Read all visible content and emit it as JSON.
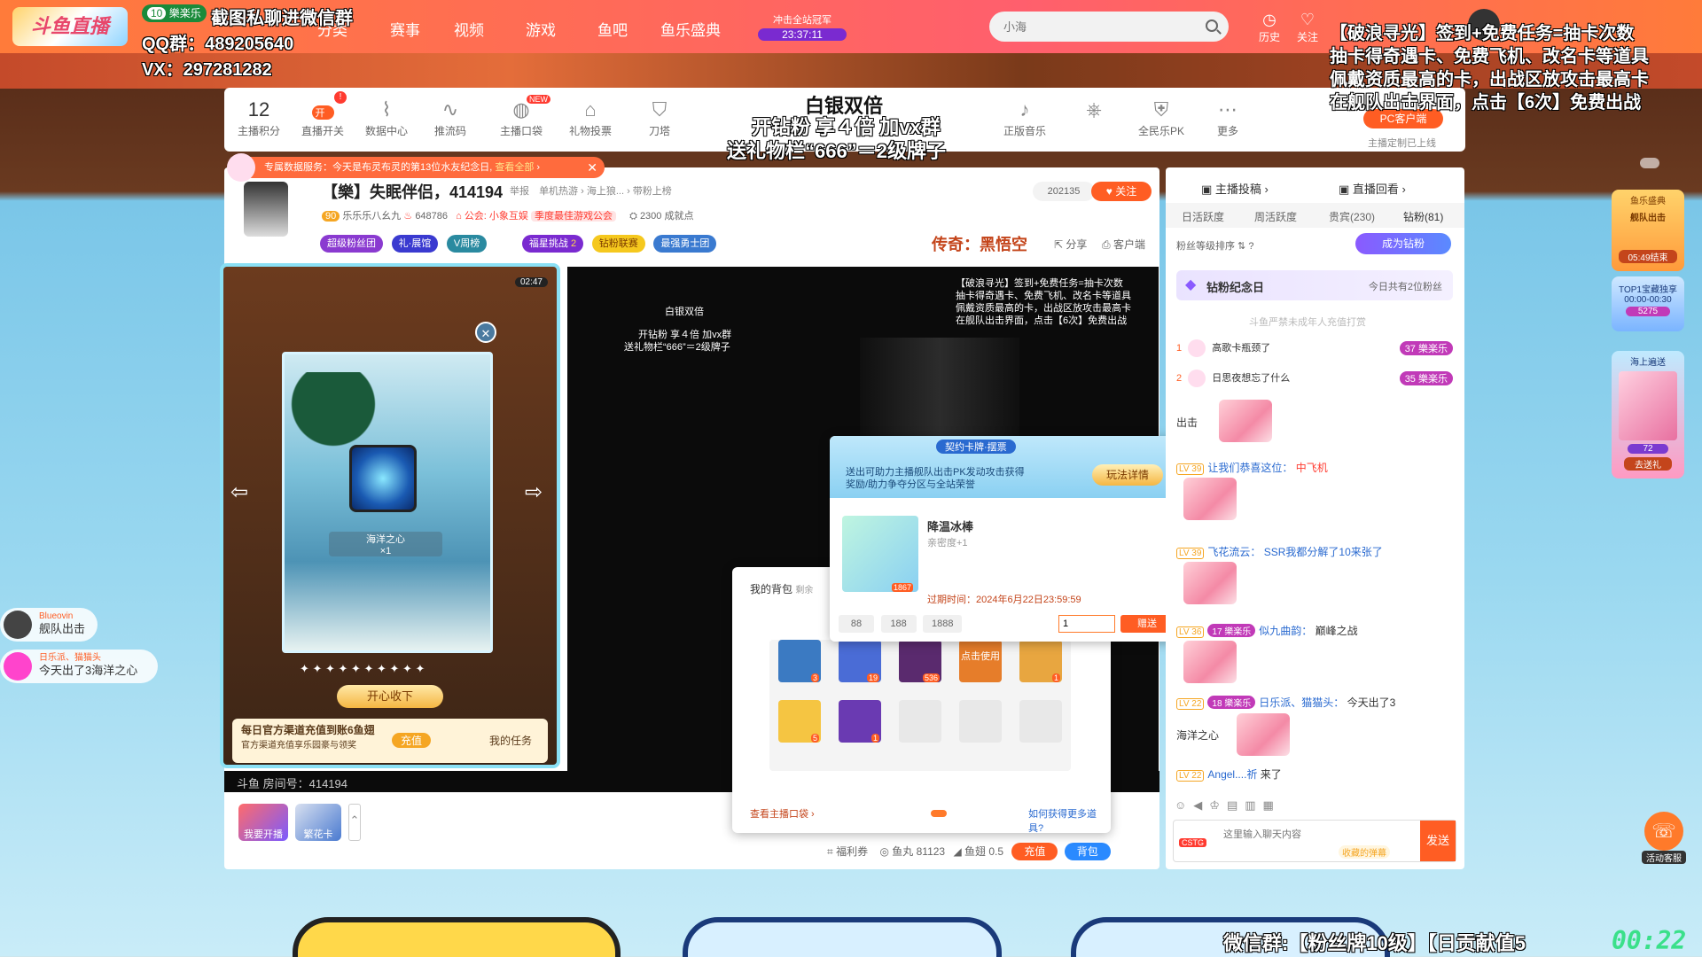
{
  "header": {
    "logo": "斗鱼直播",
    "fan_badge_level": "10",
    "fan_badge_name": "樂楽乐",
    "nav": [
      "分类",
      "赛事",
      "视频",
      "游戏",
      "鱼吧",
      "鱼乐盛典"
    ],
    "promo_title": "冲击全站冠军",
    "promo_timer": "23:37:11",
    "search_placeholder": "小海",
    "icons": [
      {
        "name": "history-icon",
        "label": "历史"
      },
      {
        "name": "follow-icon",
        "label": "关注"
      }
    ]
  },
  "overlay": {
    "screenshot_note": "截图私聊进微信群",
    "qq_group": "QQ群：489205640",
    "vx": "VX：297281282",
    "right_notice": [
      "【破浪寻光】签到+免费任务=抽卡次数",
      "抽卡得奇遇卡、免费飞机、改名卡等道具",
      "佩戴资质最高的卡，出战区放攻击最高卡",
      "在舰队出击界面，点击【6次】免费出战"
    ],
    "center_top": "白银双倍",
    "center_l1": "开钻粉 享４倍 加vx群",
    "center_l2": "送礼物栏“666”＝2级牌子",
    "bottom_right": "微信群:【粉丝牌10级】【日贡献值5",
    "bottom_timer": "00:22"
  },
  "toolbar": {
    "items": [
      {
        "name": "anchor-points",
        "value": "12",
        "label": "主播积分"
      },
      {
        "name": "live-toggle",
        "label": "直播开关",
        "toggle": "开"
      },
      {
        "name": "data-center",
        "label": "数据中心",
        "icon": "chart-icon"
      },
      {
        "name": "stream-code",
        "label": "推流码",
        "icon": "wave-icon"
      },
      {
        "name": "anchor-bag",
        "label": "主播口袋",
        "icon": "bag-icon",
        "badge": "NEW"
      },
      {
        "name": "gift-vote",
        "label": "礼物投票",
        "icon": "vote-icon"
      },
      {
        "name": "sword-tower",
        "label": "刀塔",
        "icon": "shield-icon"
      },
      {
        "name": "music",
        "label": "正版音乐",
        "icon": "music-icon"
      },
      {
        "name": "gift",
        "label": "",
        "icon": "gift-icon"
      },
      {
        "name": "pk",
        "label": "全民乐PK",
        "icon": "pk-icon"
      },
      {
        "name": "more",
        "label": "更多",
        "icon": "more-icon"
      }
    ],
    "pc_client": "PC客户端",
    "custom_note": "主播定制已上线"
  },
  "room": {
    "notice": "专属数据服务：今天是布灵布灵的第13位水友纪念日,",
    "notice_link": "查看全部",
    "title": "【樂】失眠伴侣，414194",
    "report": "举报",
    "breadcrumb": [
      "单机热游",
      "海上狼...",
      "带粉上榜"
    ],
    "level_badge": "90",
    "anchor_name": "乐乐乐八幺九",
    "heat": "648786",
    "guild": "公会: 小象互娱",
    "guild_tag": "季度最佳游戏公会",
    "achievements": "2300 成就点",
    "follower_count": "202135",
    "follow_label": "关注",
    "tags": [
      "超级粉丝团",
      "礼·展馆",
      "V周榜",
      "福星挑战",
      "钻粉联赛",
      "最强勇士团"
    ],
    "fuxing_level": "2",
    "game_name": "传奇：黑悟空",
    "share": "分享",
    "client": "客户端",
    "room_no": "斗鱼 房间号：414194",
    "bottom_actions": [
      "我要开播",
      "繁花卡"
    ],
    "wallet": {
      "fuli": "福利券",
      "yuwan": "鱼丸 81123",
      "yuchi": "鱼翅 0.5",
      "recharge": "充值",
      "backpack": "背包"
    }
  },
  "card_popup": {
    "timer": "02:47",
    "card_name": "海洋之心",
    "card_count": "×1",
    "collect_button": "开心收下",
    "task_title": "每日官方渠道充值到账6鱼翅",
    "task_desc": "官方渠道充值享乐园豪与领奖",
    "task_btn": "充值",
    "my_task": "我的任务",
    "stars": "✦ ✦ ✦ ✦ ✦ ✦ ✦ ✦ ✦ ✦"
  },
  "gift_tip": {
    "banner_tag": "契约卡牌·摆票",
    "banner_text_1": "送出可助力主播舰队出击PK发动攻击获得",
    "banner_text_2": "奖励/助力争夺分区与全站荣誉",
    "rule_btn": "玩法详情",
    "gift_name": "降温冰棒",
    "intimacy": "亲密度+1",
    "stock": "1867",
    "expire": "过期时间：2024年6月22日23:59:59",
    "quick_qty": [
      "88",
      "188",
      "1888"
    ],
    "qty_value": "1",
    "send": "赠送"
  },
  "backpack": {
    "title": "我的背包",
    "remain": "剩余",
    "slots": [
      {
        "name": "ocean-heart-slot",
        "count": "3",
        "color": "#3b7ac2"
      },
      {
        "name": "blue-card-slot",
        "count": "19",
        "color": "#4a6cd6"
      },
      {
        "name": "v-badge-slot",
        "count": "536",
        "color": "#5a2a6e"
      },
      {
        "name": "click-use-slot",
        "count": "",
        "label": "点击使用",
        "color": "#e67d2a"
      },
      {
        "name": "ticket-slot",
        "count": "1",
        "color": "#e8a640"
      },
      {
        "name": "horn-slot",
        "count": "5",
        "color": "#f5c542"
      },
      {
        "name": "purple-card-slot",
        "count": "1",
        "color": "#6a3ab2"
      }
    ],
    "view_bag": "查看主播口袋",
    "how_more": "如何获得更多道具?"
  },
  "chat": {
    "tabs_top": [
      "主播投稿",
      "直播回看"
    ],
    "tabs": [
      "日活跃度",
      "周活跃度",
      "贵宾(230)",
      "钻粉(81)"
    ],
    "fan_rank_label": "粉丝等级排序",
    "become_diamond": "成为钻粉",
    "diamond_day": "钻粉纪念日",
    "diamond_today": "今日共有2位粉丝",
    "minor_notice": "斗鱼严禁未成年人充值打赏",
    "rank": [
      {
        "no": "1",
        "name": "高歌卡瓶颈了",
        "level": "37",
        "fan": "樂楽乐"
      },
      {
        "no": "2",
        "name": "日思夜想忘了什么",
        "level": "35",
        "fan": "樂楽乐"
      }
    ],
    "messages": [
      {
        "text": "出击"
      },
      {
        "lv": "LV 39",
        "user": "让我们恭喜这位：",
        "text": "中飞机"
      },
      {
        "lv": "LV 39",
        "user": "飞花流云：",
        "text": "SSR我都分解了10来张了"
      },
      {
        "lv": "LV 36",
        "fan": "17 樂楽乐",
        "user": "似九曲韵：",
        "text": "巅峰之战"
      },
      {
        "lv": "LV 22",
        "fan": "18 樂楽乐",
        "user": "日乐派、猫猫头：",
        "text": "今天出了3"
      },
      {
        "text": "海洋之心"
      },
      {
        "lv": "LV 22",
        "user": "Angel....祈",
        "text": "来了"
      }
    ],
    "input_placeholder": "这里输入聊天内容",
    "send": "发送",
    "collect": "收藏的弹幕",
    "cstg": "CSTG"
  },
  "side_bubbles": [
    {
      "name": "Blueovin",
      "text": "舰队出击"
    },
    {
      "name": "日乐派、猫猫头",
      "text": "今天出了3海洋之心"
    }
  ],
  "right_widgets": {
    "event1": "鱼乐盛典",
    "event1_sub": "舰队出击",
    "event1_timer": "05:49结束",
    "top1": "TOP1宝藏独享",
    "top1_time": "00:00-00:30",
    "top1_val": "5275",
    "event2": "海上遍送",
    "event2_val": "72",
    "event2_btn": "去送礼",
    "service": "活动客服"
  }
}
